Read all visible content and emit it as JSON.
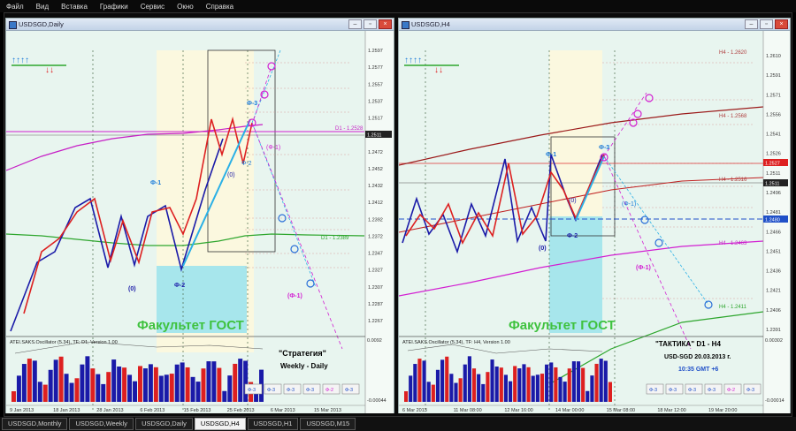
{
  "menu": [
    "Файл",
    "Вид",
    "Вставка",
    "Графики",
    "Сервис",
    "Окно",
    "Справка"
  ],
  "left": {
    "title": "USDSGD,Daily",
    "watermark": "Факультет ГОСТ",
    "strategy_title": "\"Стратегия\"",
    "strategy_sub": "Weekly - Daily",
    "osc_label": "ATEI.SAKS.Oscillator (5.34), TF: D1, Version 1.00",
    "osc_top": "0.0092",
    "osc_bottom": "-0.00044",
    "price_levels": [
      "1.2597",
      "1.2577",
      "1.2557",
      "1.2537",
      "1.2517",
      "1.2497",
      "1.2472",
      "1.2452",
      "1.2432",
      "1.2412",
      "1.2392",
      "1.2372",
      "1.2347",
      "1.2327",
      "1.2307",
      "1.2287",
      "1.2267"
    ],
    "current_price": "1.2511",
    "dates": [
      "9 Jan 2013",
      "18 Jan 2013",
      "28 Jan 2013",
      "6 Feb 2013",
      "15 Feb 2013",
      "25 Feb 2013",
      "6 Mar 2013",
      "15 Mar 2013"
    ],
    "labels": {
      "phi1": "Ф-1",
      "phi2": "Ф-2",
      "zero": "(0)",
      "phi3": "Ф-3",
      "phi1b": "(Ф-1)",
      "phi2b": "Ф-2",
      "zero2": "(0)",
      "mphi1": "(Ф-1)",
      "d1": "D1 - 1.2528",
      "d1b": "D1 - 1.2389"
    },
    "buttons": [
      "Ф-3",
      "Ф-3",
      "Ф-3",
      "Ф-3",
      "Ф-2",
      "Ф-3"
    ]
  },
  "right": {
    "title": "USDSGD,H4",
    "watermark": "Факультет ГОСТ",
    "tactic_title": "\"ТАКТИКА\"   D1 - H4",
    "tactic_sub": "USD-SGD    20.03.2013 г.",
    "tactic_time": "10:35  GMT +6",
    "osc_label": "ATEI.SAKS.Oscillator (5.34), TF: H4, Version 1.00",
    "osc_top": "0.00302",
    "osc_bottom": "-0.00014",
    "price_levels": [
      "1.2610",
      "1.2591",
      "1.2571",
      "1.2556",
      "1.2541",
      "1.2526",
      "1.2511",
      "1.2496",
      "1.2481",
      "1.2466",
      "1.2451",
      "1.2436",
      "1.2421",
      "1.2406",
      "1.2391"
    ],
    "current_price": "1.2511",
    "red_price": "1.2527",
    "blue_price": "1.2480",
    "dates": [
      "6 Mar 2013",
      "11 Mar 08:00",
      "12 Mar 16:00",
      "14 Mar 00:00",
      "15 Mar 08:00",
      "18 Mar 12:00",
      "19 Mar 20:00"
    ],
    "labels": {
      "h4a": "H4 - 1.2620",
      "h4b": "H4 - 1.2568",
      "h4c": "H4 - 1.2516",
      "h4d": "H4 - 1.2463",
      "h4e": "H4 - 1.2411",
      "phi1": "Ф-1",
      "phi2": "Ф-2",
      "zero": "(0)",
      "zero2": "(0)",
      "phi3": "Ф-3",
      "mphi1": "(Ф-1)",
      "phi1b": "(Ф-1)"
    },
    "buttons": [
      "Ф-3",
      "Ф-3",
      "Ф-3",
      "Ф-3",
      "Ф-2",
      "Ф-3"
    ]
  },
  "tabs": [
    "USDSGD,Monthly",
    "USDSGD,Weekly",
    "USDSGD,Daily",
    "USDSGD,H4",
    "USDSGD,H1",
    "USDSGD,M15"
  ],
  "active_tab": 3,
  "colors": {
    "bg_chart": "#e8f5ef",
    "fibo_zone": "#fbf8df",
    "cyan_zone": "#a7e6ec",
    "blue": "#1a1aa8",
    "red": "#dd2020",
    "pink": "#d21fd2",
    "green": "#2ea62e",
    "brown": "#9b1a1a",
    "cyan": "#2ab0e6",
    "watermark": "#3fc23f"
  }
}
